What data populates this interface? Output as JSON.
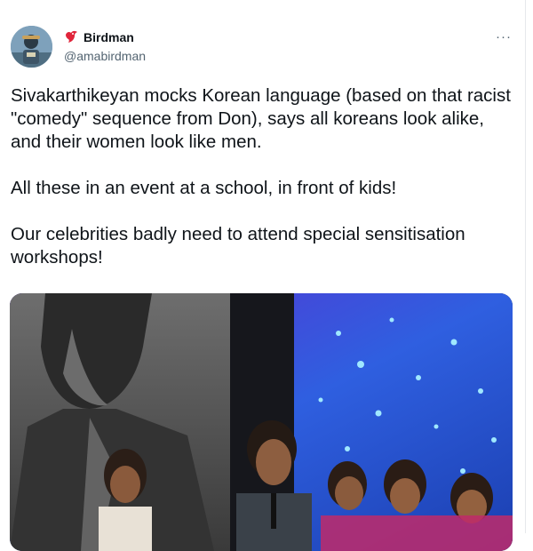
{
  "author": {
    "display_name": "Birdman",
    "handle": "@amabirdman"
  },
  "menu": {
    "more_label": "···"
  },
  "tweet": {
    "paragraphs": [
      "Sivakarthikeyan mocks Korean language (based on that racist \"comedy\" sequence from Don), says all koreans look alike, and their women look like men.",
      "All these in an event at a school, in front of kids!",
      "Our celebrities badly need to attend special sensitisation workshops!"
    ]
  },
  "media": {
    "description": "photo of a man speaking into a microphone on stage with a group of women, a poster on the left and a purple-blue backdrop with lights on the right"
  },
  "icons": {
    "verified": "red-bird-icon",
    "more": "more-options-icon"
  },
  "colors": {
    "text": "#0f1419",
    "secondary": "#536471",
    "bird": "#e0243a"
  }
}
